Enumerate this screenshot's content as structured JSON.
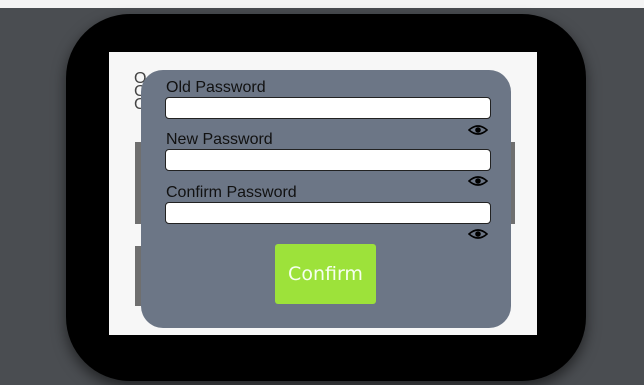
{
  "background_text": {
    "line_1": "O",
    "line_2": "C",
    "line_3": "C"
  },
  "change_password_modal": {
    "old_password": {
      "label": "Old Password",
      "value": "",
      "toggle_icon": "eye-icon"
    },
    "new_password": {
      "label": "New Password",
      "value": "",
      "toggle_icon": "eye-icon"
    },
    "confirm_password": {
      "label": "Confirm Password",
      "value": "",
      "toggle_icon": "eye-icon"
    },
    "confirm_label": "Confirm"
  },
  "colors": {
    "page_background": "#4a4d51",
    "device_frame": "#000000",
    "screen_background": "#f7f7f7",
    "modal_background": "#6c7686",
    "confirm_button": "#9de23a",
    "confirm_text": "#f6fff0"
  }
}
